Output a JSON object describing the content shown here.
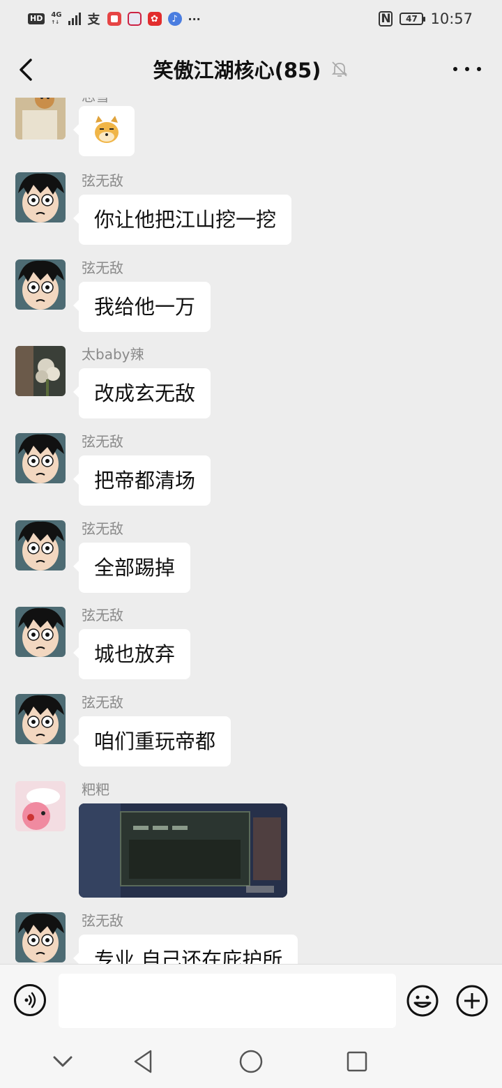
{
  "status_bar": {
    "hd": "HD",
    "network": "4G",
    "network_sub": "↑↓",
    "more": "···",
    "battery": "47",
    "time": "10:57"
  },
  "header": {
    "title": "笑傲江湖核心(85)"
  },
  "messages": [
    {
      "sender": "忘雪",
      "text": "",
      "type": "sticker",
      "avatar": "dog-avatar"
    },
    {
      "sender": "弦无敌",
      "text": "你让他把江山挖一挖",
      "type": "text",
      "avatar": "luffy-avatar"
    },
    {
      "sender": "弦无敌",
      "text": "我给他一万",
      "type": "text",
      "avatar": "luffy-avatar"
    },
    {
      "sender": "太baby辣",
      "text": "改成玄无敌",
      "type": "text",
      "avatar": "flower-avatar"
    },
    {
      "sender": "弦无敌",
      "text": "把帝都清场",
      "type": "text",
      "avatar": "luffy-avatar"
    },
    {
      "sender": "弦无敌",
      "text": "全部踢掉",
      "type": "text",
      "avatar": "luffy-avatar"
    },
    {
      "sender": "弦无敌",
      "text": "城也放弃",
      "type": "text",
      "avatar": "luffy-avatar"
    },
    {
      "sender": "弦无敌",
      "text": "咱们重玩帝都",
      "type": "text",
      "avatar": "luffy-avatar"
    },
    {
      "sender": "粑粑",
      "text": "",
      "type": "image",
      "avatar": "pink-cartoon-avatar"
    },
    {
      "sender": "弦无敌",
      "text": "专业 自己还在庇护所",
      "type": "text",
      "avatar": "luffy-avatar"
    }
  ],
  "input": {
    "placeholder": ""
  },
  "colors": {
    "background": "#ededed",
    "bubble": "#ffffff",
    "sender_text": "#8a8a8a"
  }
}
